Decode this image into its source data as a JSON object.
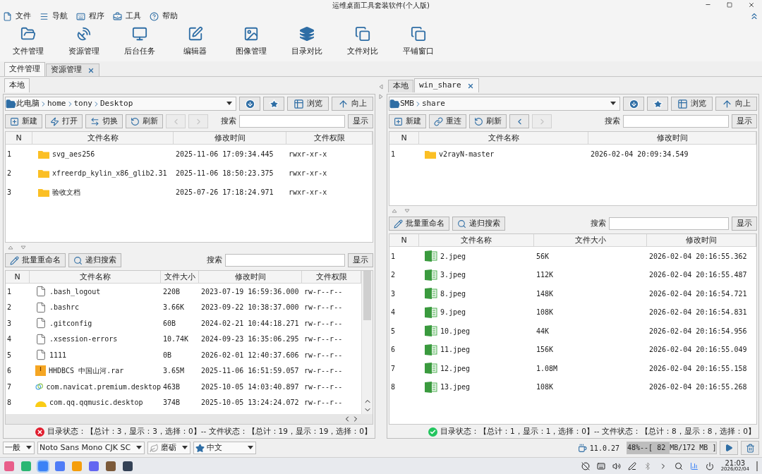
{
  "window": {
    "title": "运维桌面工具套装软件(个人版)"
  },
  "menu": [
    {
      "label": "文件",
      "kind": "file"
    },
    {
      "label": "导航",
      "kind": "nav"
    },
    {
      "label": "程序",
      "kind": "program"
    },
    {
      "label": "工具",
      "kind": "tools"
    },
    {
      "label": "帮助",
      "kind": "help"
    }
  ],
  "toolbar": [
    {
      "label": "文件管理",
      "kind": "folder"
    },
    {
      "label": "资源管理",
      "kind": "dish"
    },
    {
      "label": "后台任务",
      "kind": "monitor"
    },
    {
      "label": "编辑器",
      "kind": "edit"
    },
    {
      "label": "图像管理",
      "kind": "image"
    },
    {
      "label": "目录对比",
      "kind": "stack"
    },
    {
      "label": "文件对比",
      "kind": "copy"
    },
    {
      "label": "平铺窗口",
      "kind": "tile"
    }
  ],
  "main_tabs": [
    {
      "label": "文件管理",
      "selected": true,
      "closable": false
    },
    {
      "label": "资源管理",
      "selected": false,
      "closable": true
    }
  ],
  "panes": [
    {
      "tabs": [
        {
          "label": "本地",
          "selected": true,
          "closable": false
        }
      ],
      "path": [
        "此电脑",
        "home",
        "tony",
        "Desktop"
      ],
      "path_buttons": [
        {
          "kind": "download"
        },
        {
          "kind": "star"
        },
        {
          "kind": "browse",
          "label": "浏览"
        },
        {
          "kind": "up",
          "label": "向上"
        }
      ],
      "actions": [
        {
          "kind": "new",
          "label": "新建",
          "disabled": false
        },
        {
          "kind": "open",
          "label": "打开",
          "disabled": false
        },
        {
          "kind": "switch",
          "label": "切换",
          "disabled": false
        },
        {
          "kind": "refresh",
          "label": "刷新",
          "disabled": false
        },
        {
          "kind": "back",
          "disabled": true
        },
        {
          "kind": "forward",
          "disabled": true
        }
      ],
      "search_label": "搜索",
      "show_button": "显示",
      "dir_table": {
        "columns": [
          "N",
          "文件名称",
          "修改时间",
          "文件权限"
        ],
        "rows": [
          {
            "kind": "folder",
            "cells": [
              "1",
              "svg_aes256",
              "2025-11-06 17:09:34.445",
              "rwxr-xr-x"
            ]
          },
          {
            "kind": "folder",
            "cells": [
              "2",
              "xfreerdp_kylin_x86_glib2.31",
              "2025-11-06 18:50:23.375",
              "rwxr-xr-x"
            ]
          },
          {
            "kind": "folder",
            "cells": [
              "3",
              "验收文档",
              "2025-07-26 17:18:24.971",
              "rwxr-xr-x"
            ]
          }
        ]
      },
      "file_actions": [
        {
          "kind": "rename",
          "label": "批量重命名"
        },
        {
          "kind": "search",
          "label": "递归搜索"
        }
      ],
      "file_search_label": "搜索",
      "file_show_button": "显示",
      "file_table": {
        "columns": [
          "N",
          "文件名称",
          "文件大小",
          "修改时间",
          "文件权限"
        ],
        "rows": [
          {
            "kind": "file",
            "cells": [
              "1",
              ".bash_logout",
              "220B",
              "2023-07-19 16:59:36.000",
              "rw-r--r--"
            ]
          },
          {
            "kind": "file",
            "cells": [
              "2",
              ".bashrc",
              "3.66K",
              "2023-09-22 10:38:37.000",
              "rw-r--r--"
            ]
          },
          {
            "kind": "file",
            "cells": [
              "3",
              ".gitconfig",
              "60B",
              "2024-02-21 10:44:18.271",
              "rw-r--r--"
            ]
          },
          {
            "kind": "file",
            "cells": [
              "4",
              ".xsession-errors",
              "10.74K",
              "2024-09-23 16:35:06.295",
              "rw-r--r--"
            ]
          },
          {
            "kind": "file",
            "cells": [
              "5",
              "1111",
              "0B",
              "2026-02-01 12:40:37.606",
              "rw-r--r--"
            ]
          },
          {
            "kind": "rar",
            "cells": [
              "6",
              "HHDBCS 中国山河.rar",
              "3.65M",
              "2025-11-06 16:51:59.057",
              "rw-r--r--"
            ]
          },
          {
            "kind": "navicat",
            "cells": [
              "7",
              "com.navicat.premium.desktop",
              "463B",
              "2025-10-05 14:03:40.897",
              "rw-r--r--"
            ]
          },
          {
            "kind": "music",
            "cells": [
              "8",
              "com.qq.qqmusic.desktop",
              "374B",
              "2025-10-05 13:24:24.072",
              "rw-r--r--"
            ]
          }
        ]
      },
      "status": {
        "ok": false,
        "text": "目录状态：【总计：3，显示：3，选择：0】-- 文件状态：【总计：19，显示：19，选择：0】"
      }
    },
    {
      "tabs": [
        {
          "label": "本地",
          "selected": false,
          "closable": false
        },
        {
          "label": "win_share",
          "selected": true,
          "closable": true
        }
      ],
      "path": [
        "SMB",
        "share"
      ],
      "path_buttons": [
        {
          "kind": "download"
        },
        {
          "kind": "star"
        },
        {
          "kind": "browse",
          "label": "浏览"
        },
        {
          "kind": "up",
          "label": "向上"
        }
      ],
      "actions": [
        {
          "kind": "new",
          "label": "新建",
          "disabled": false
        },
        {
          "kind": "reconnect",
          "label": "重连",
          "disabled": false
        },
        {
          "kind": "refresh",
          "label": "刷新",
          "disabled": false
        },
        {
          "kind": "back",
          "disabled": false
        },
        {
          "kind": "forward",
          "disabled": true
        }
      ],
      "search_label": "搜索",
      "show_button": "显示",
      "dir_table": {
        "columns": [
          "N",
          "文件名称",
          "修改时间"
        ],
        "rows": [
          {
            "kind": "folder",
            "cells": [
              "1",
              "v2rayN-master",
              "2026-02-04 20:09:34.549"
            ]
          }
        ]
      },
      "file_actions": [
        {
          "kind": "rename",
          "label": "批量重命名"
        },
        {
          "kind": "search",
          "label": "递归搜索"
        }
      ],
      "file_search_label": "搜索",
      "file_show_button": "显示",
      "file_table": {
        "columns": [
          "N",
          "文件名称",
          "文件大小",
          "修改时间"
        ],
        "rows": [
          {
            "kind": "jpeg",
            "cells": [
              "1",
              "2.jpeg",
              "56K",
              "2026-02-04 20:16:55.362"
            ]
          },
          {
            "kind": "jpeg",
            "cells": [
              "2",
              "3.jpeg",
              "112K",
              "2026-02-04 20:16:55.487"
            ]
          },
          {
            "kind": "jpeg",
            "cells": [
              "3",
              "8.jpeg",
              "148K",
              "2026-02-04 20:16:54.721"
            ]
          },
          {
            "kind": "jpeg",
            "cells": [
              "4",
              "9.jpeg",
              "108K",
              "2026-02-04 20:16:54.831"
            ]
          },
          {
            "kind": "jpeg",
            "cells": [
              "5",
              "10.jpeg",
              "44K",
              "2026-02-04 20:16:54.956"
            ]
          },
          {
            "kind": "jpeg",
            "cells": [
              "6",
              "11.jpeg",
              "156K",
              "2026-02-04 20:16:55.049"
            ]
          },
          {
            "kind": "jpeg",
            "cells": [
              "7",
              "12.jpeg",
              "1.08M",
              "2026-02-04 20:16:55.158"
            ]
          },
          {
            "kind": "jpeg",
            "cells": [
              "8",
              "13.jpeg",
              "108K",
              "2026-02-04 20:16:55.268"
            ]
          }
        ]
      },
      "status": {
        "ok": true,
        "text": "目录状态：【总计：1，显示：1，选择：0】-- 文件状态：【总计：8，显示：8，选择：0】"
      }
    }
  ],
  "bottom_selects": [
    {
      "kind": "plain",
      "value": "一般"
    },
    {
      "kind": "plain",
      "value": "Noto Sans Mono CJK SC"
    },
    {
      "kind": "leaf",
      "value": "磨砺"
    },
    {
      "kind": "star",
      "value": "中文"
    }
  ],
  "java_version": "11.0.27",
  "memory": {
    "text": "48%--[ 82 MB/172 MB ]",
    "level": 0.48
  },
  "taskbar": {
    "apps": [
      {
        "color": "#e85d8a",
        "selected": false
      },
      {
        "color": "#2bb673",
        "selected": false
      },
      {
        "color": "#3b82f6",
        "selected": true
      },
      {
        "color": "#4f7cf7",
        "selected": false
      },
      {
        "color": "#f59e0b",
        "selected": false
      },
      {
        "color": "#6366f1",
        "selected": false
      },
      {
        "color": "#7c5a3a",
        "selected": false
      },
      {
        "color": "#334155",
        "selected": false
      }
    ],
    "time": "21:03",
    "date": "2026/02/04"
  }
}
